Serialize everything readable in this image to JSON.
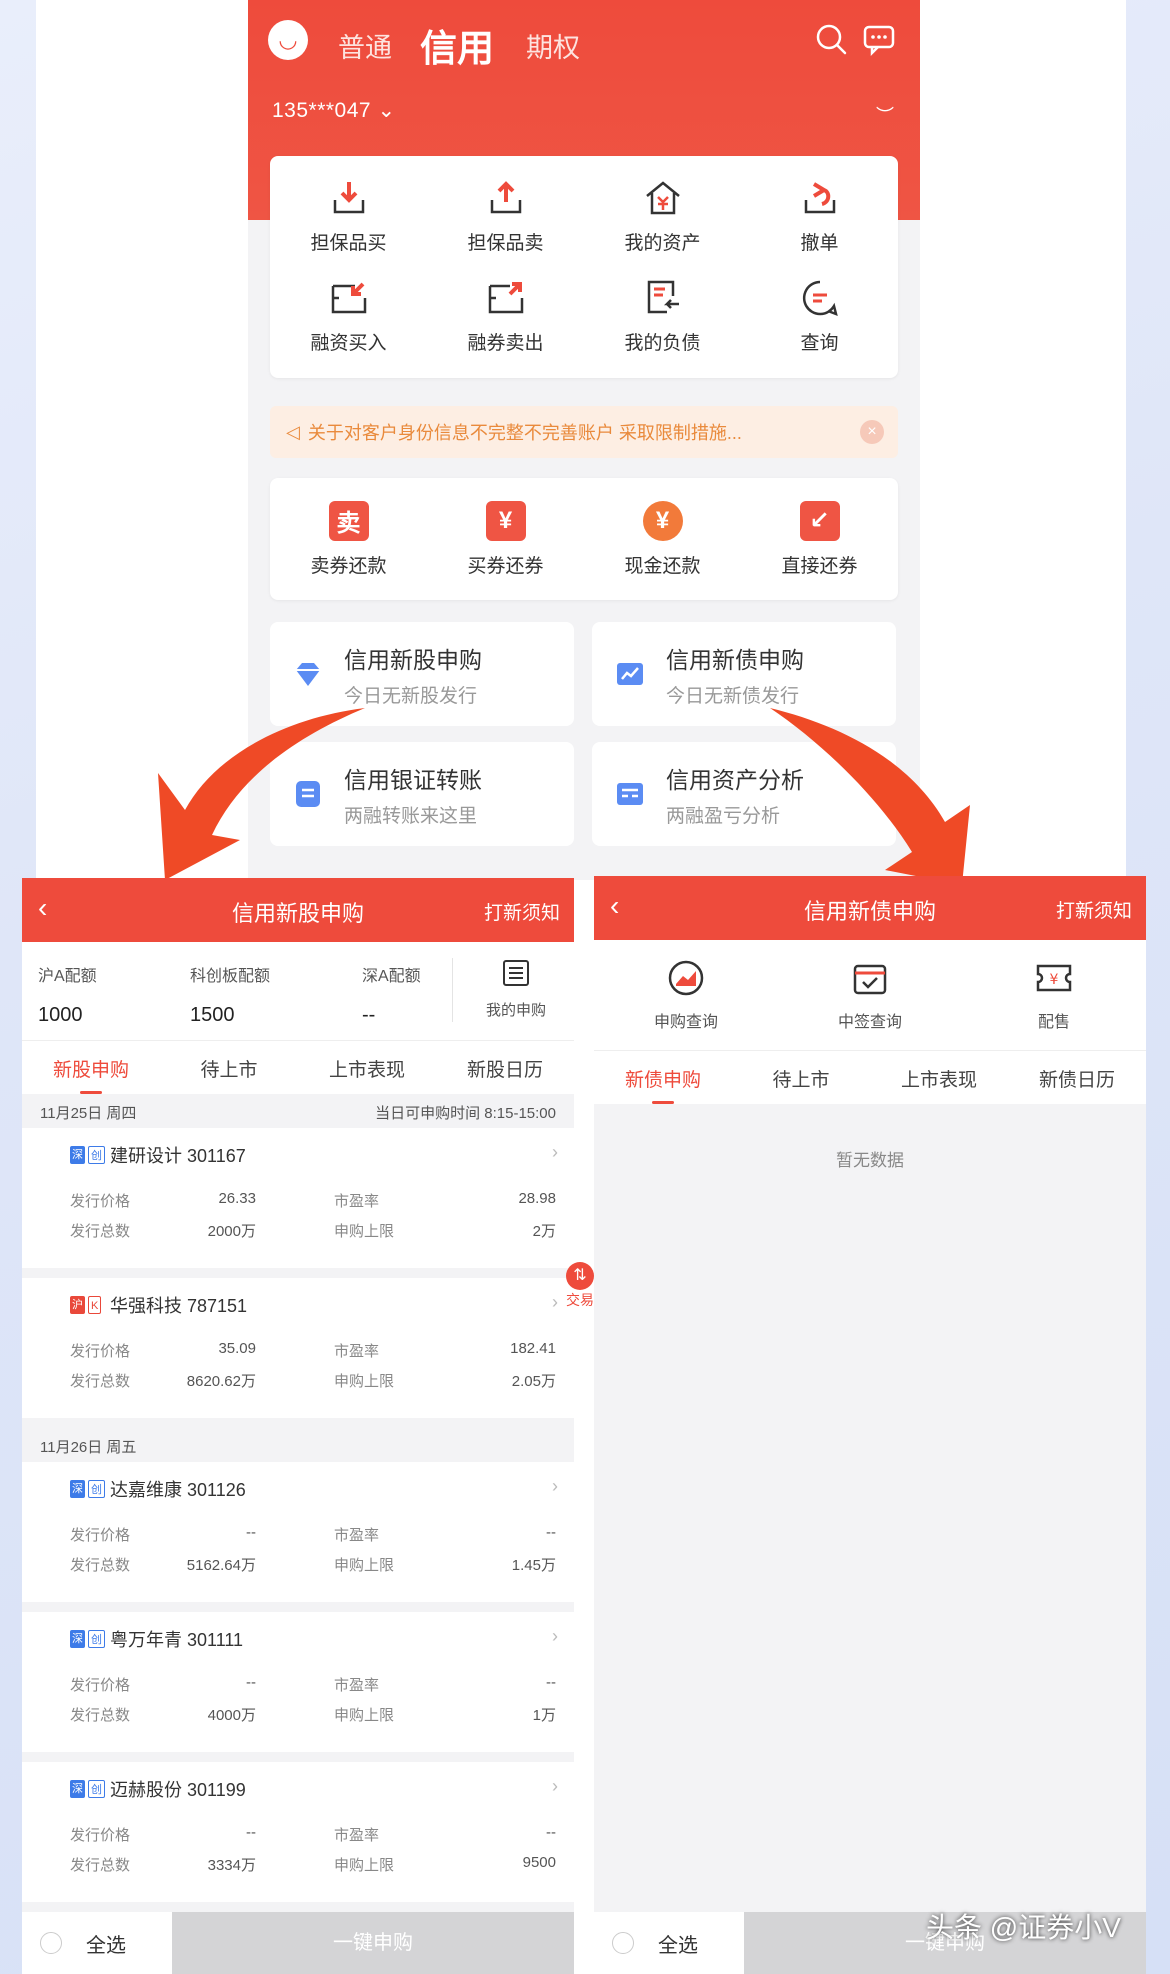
{
  "top": {
    "modes": [
      "普通",
      "信用",
      "期权"
    ],
    "account": "135***047",
    "functions": [
      "担保品买",
      "担保品卖",
      "我的资产",
      "撤单",
      "融资买入",
      "融券卖出",
      "我的负债",
      "查询"
    ],
    "notice": "关于对客户身份信息不完整不完善账户 采取限制措施...",
    "repay": [
      {
        "icon": "卖",
        "label": "卖券还款"
      },
      {
        "icon": "¥",
        "label": "买券还券"
      },
      {
        "icon": "¥",
        "label": "现金还款"
      },
      {
        "icon": "",
        "label": "直接还券"
      }
    ],
    "tiles": [
      {
        "title": "信用新股申购",
        "sub": "今日无新股发行"
      },
      {
        "title": "信用新债申购",
        "sub": "今日无新债发行"
      },
      {
        "title": "信用银证转账",
        "sub": "两融转账来这里"
      },
      {
        "title": "信用资产分析",
        "sub": "两融盈亏分析"
      }
    ]
  },
  "left": {
    "title": "信用新股申购",
    "notice_link": "打新须知",
    "quota": {
      "sh_label": "沪A配额",
      "sh_value": "1000",
      "kc_label": "科创板配额",
      "kc_value": "1500",
      "sz_label": "深A配额",
      "sz_value": "--",
      "mine_label": "我的申购"
    },
    "tabs": [
      "新股申购",
      "待上市",
      "上市表现",
      "新股日历"
    ],
    "date1": "11月25日 周四",
    "hours": "当日可申购时间 8:15-15:00",
    "date2": "11月26日 周五",
    "labels": {
      "price": "发行价格",
      "total": "发行总数",
      "pe": "市盈率",
      "limit": "申购上限"
    },
    "stocks": [
      {
        "market": "深",
        "board": "创",
        "name": "建研设计 301167",
        "price": "26.33",
        "total": "2000万",
        "pe": "28.98",
        "limit": "2万"
      },
      {
        "market": "沪",
        "board": "K",
        "name": "华强科技 787151",
        "price": "35.09",
        "total": "8620.62万",
        "pe": "182.41",
        "limit": "2.05万"
      },
      {
        "market": "深",
        "board": "创",
        "name": "达嘉维康 301126",
        "price": "--",
        "total": "5162.64万",
        "pe": "--",
        "limit": "1.45万"
      },
      {
        "market": "深",
        "board": "创",
        "name": "粤万年青 301111",
        "price": "--",
        "total": "4000万",
        "pe": "--",
        "limit": "1万"
      },
      {
        "market": "深",
        "board": "创",
        "name": "迈赫股份 301199",
        "price": "--",
        "total": "3334万",
        "pe": "--",
        "limit": "9500"
      }
    ],
    "select_all": "全选",
    "one_click": "一键申购"
  },
  "right": {
    "title": "信用新债申购",
    "notice_link": "打新须知",
    "quick": [
      "申购查询",
      "中签查询",
      "配售"
    ],
    "tabs": [
      "新债申购",
      "待上市",
      "上市表现",
      "新债日历"
    ],
    "empty": "暂无数据",
    "select_all": "全选",
    "one_click": "一键申购"
  },
  "float_label": "交易",
  "watermark": "头条 @证券小V",
  "colors": {
    "brand_red": "#ee4b3c",
    "orange": "#f27a3a",
    "notice_text": "#e98a3c"
  }
}
